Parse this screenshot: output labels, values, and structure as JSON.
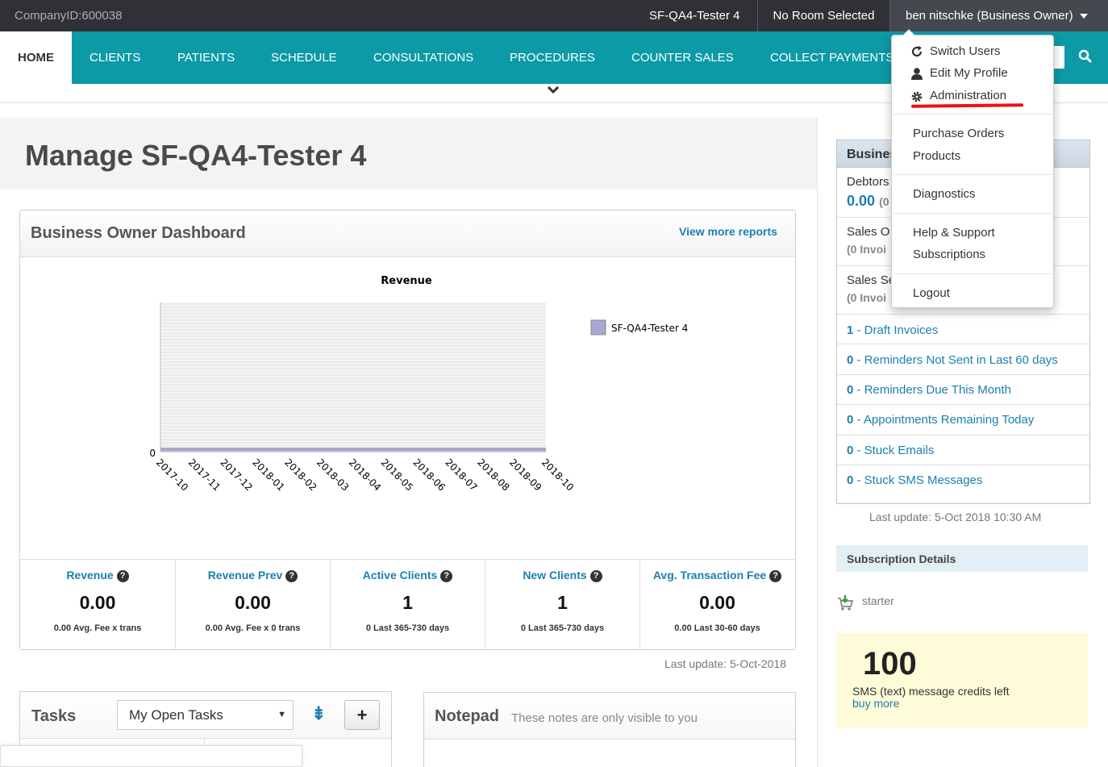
{
  "topbar": {
    "company": "CompanyID:600038",
    "site": "SF-QA4-Tester 4",
    "room": "No Room Selected",
    "user": "ben nitschke (Business Owner)"
  },
  "nav": {
    "home": "HOME",
    "clients": "CLIENTS",
    "patients": "PATIENTS",
    "schedule": "SCHEDULE",
    "consultations": "CONSULTATIONS",
    "procedures": "PROCEDURES",
    "counter_sales": "COUNTER SALES",
    "collect_payments": "COLLECT PAYMENTS"
  },
  "page_title": "Manage SF-QA4-Tester 4",
  "dashboard": {
    "title": "Business Owner Dashboard",
    "view_more": "View more reports",
    "last_update": "Last update: 5-Oct-2018",
    "stats": [
      {
        "label": "Revenue",
        "value": "0.00",
        "sub": "0.00 Avg. Fee x trans"
      },
      {
        "label": "Revenue Prev",
        "value": "0.00",
        "sub": "0.00 Avg. Fee x 0 trans"
      },
      {
        "label": "Active Clients",
        "value": "1",
        "sub": "0 Last 365-730 days"
      },
      {
        "label": "New Clients",
        "value": "1",
        "sub": "0 Last 365-730 days"
      },
      {
        "label": "Avg. Transaction Fee",
        "value": "0.00",
        "sub": "0.00 Last 30-60 days"
      }
    ]
  },
  "chart_data": {
    "type": "line",
    "title": "Revenue",
    "categories": [
      "2017-10",
      "2017-11",
      "2017-12",
      "2018-01",
      "2018-02",
      "2018-03",
      "2018-04",
      "2018-05",
      "2018-06",
      "2018-07",
      "2018-08",
      "2018-09",
      "2018-10"
    ],
    "series": [
      {
        "name": "SF-QA4-Tester 4",
        "values": [
          0,
          0,
          0,
          0,
          0,
          0,
          0,
          0,
          0,
          0,
          0,
          0,
          0
        ]
      }
    ],
    "yticks": [
      "0"
    ],
    "legend_position": "right",
    "series_color": "#a7a7d1",
    "grid": true
  },
  "tasks": {
    "title": "Tasks",
    "filter": "My Open Tasks",
    "add_label": "+"
  },
  "notepad": {
    "title": "Notepad",
    "subtitle": "These notes are only visible to you"
  },
  "business": {
    "title": "Business",
    "debtors_label": "Debtors",
    "debtors_value": "0.00",
    "debtors_sub": "(0",
    "sales1_label": "Sales O",
    "sales1_sub": "(0 Invoi",
    "sales2_label": "Sales Se",
    "sales2_sub": "(0 Invoi",
    "links": [
      {
        "count": "1",
        "text": " - Draft Invoices"
      },
      {
        "count": "0",
        "text": " - Reminders Not Sent in Last 60 days"
      },
      {
        "count": "0",
        "text": " - Reminders Due This Month"
      },
      {
        "count": "0",
        "text": " - Appointments Remaining Today"
      },
      {
        "count": "0",
        "text": " - Stuck Emails"
      },
      {
        "count": "0",
        "text": " - Stuck SMS Messages"
      }
    ],
    "last_update": "Last update: 5-Oct 2018 10:30 AM"
  },
  "subscription": {
    "title": "Subscription Details",
    "plan": "starter",
    "sms_count": "100",
    "sms_text": "SMS (text) message credits left",
    "buy_more": "buy more"
  },
  "user_menu": {
    "switch_users": "Switch Users",
    "edit_profile": "Edit My Profile",
    "administration": "Administration",
    "purchase_orders": "Purchase Orders",
    "products": "Products",
    "diagnostics": "Diagnostics",
    "help_support": "Help & Support",
    "subscriptions": "Subscriptions",
    "logout": "Logout",
    "highlight_color": "#e8121b"
  },
  "colors": {
    "nav": "#0c9aa7",
    "topbar": "#2f3136",
    "link": "#1c7fb0"
  }
}
